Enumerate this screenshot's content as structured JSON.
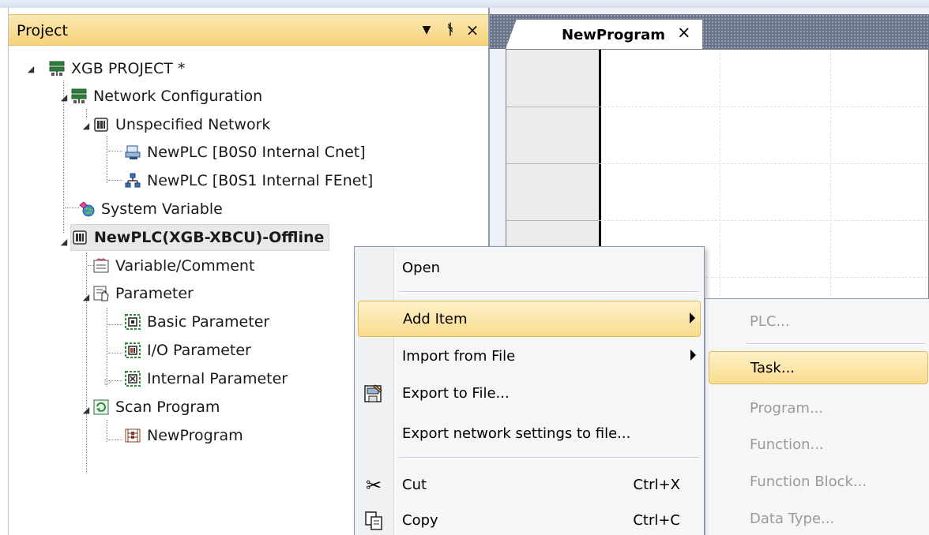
{
  "project_panel": {
    "title": "Project",
    "controls": {
      "dropdown": "▼",
      "pin": "ᵖ",
      "close": "×"
    }
  },
  "tree": {
    "root": {
      "label": "XGB PROJECT *",
      "icon": "project-icon"
    },
    "network_config": {
      "label": "Network Configuration",
      "icon": "network-config-icon"
    },
    "unspecified_network": {
      "label": "Unspecified Network",
      "icon": "plc-icon"
    },
    "cnet": {
      "label": "NewPLC [B0S0 Internal Cnet]",
      "icon": "cnet-icon"
    },
    "fenet": {
      "label": "NewPLC [B0S1 Internal FEnet]",
      "icon": "fenet-icon"
    },
    "system_variable": {
      "label": "System Variable",
      "icon": "system-variable-icon"
    },
    "plc": {
      "label": "NewPLC(XGB-XBCU)-Offline",
      "icon": "plc-icon"
    },
    "variable_comment": {
      "label": "Variable/Comment",
      "icon": "variable-comment-icon"
    },
    "parameter": {
      "label": "Parameter",
      "icon": "parameter-icon"
    },
    "basic_parameter": {
      "label": "Basic Parameter",
      "icon": "basic-parameter-icon"
    },
    "io_parameter": {
      "label": "I/O Parameter",
      "icon": "io-parameter-icon"
    },
    "internal_parameter": {
      "label": "Internal Parameter",
      "icon": "internal-parameter-icon"
    },
    "scan_program": {
      "label": "Scan Program",
      "icon": "scan-program-icon"
    },
    "new_program": {
      "label": "NewProgram",
      "icon": "ladder-program-icon"
    }
  },
  "editor": {
    "tab_label": "NewProgram",
    "tab_close": "×"
  },
  "context_menu": {
    "open": "Open",
    "add_item": "Add Item",
    "import_from_file": "Import from File",
    "export_to_file": "Export to File...",
    "export_network": "Export network settings to file...",
    "cut": "Cut",
    "cut_shortcut": "Ctrl+X",
    "copy": "Copy",
    "copy_shortcut": "Ctrl+C"
  },
  "submenu": {
    "plc": "PLC...",
    "task": "Task...",
    "program": "Program...",
    "function": "Function...",
    "function_block": "Function Block...",
    "data_type": "Data Type..."
  },
  "colors": {
    "highlight": "#f9dc8e",
    "panel_header": "#f6d27a",
    "tab_strip": "#6a7488",
    "disabled_text": "#9b9b9b"
  }
}
